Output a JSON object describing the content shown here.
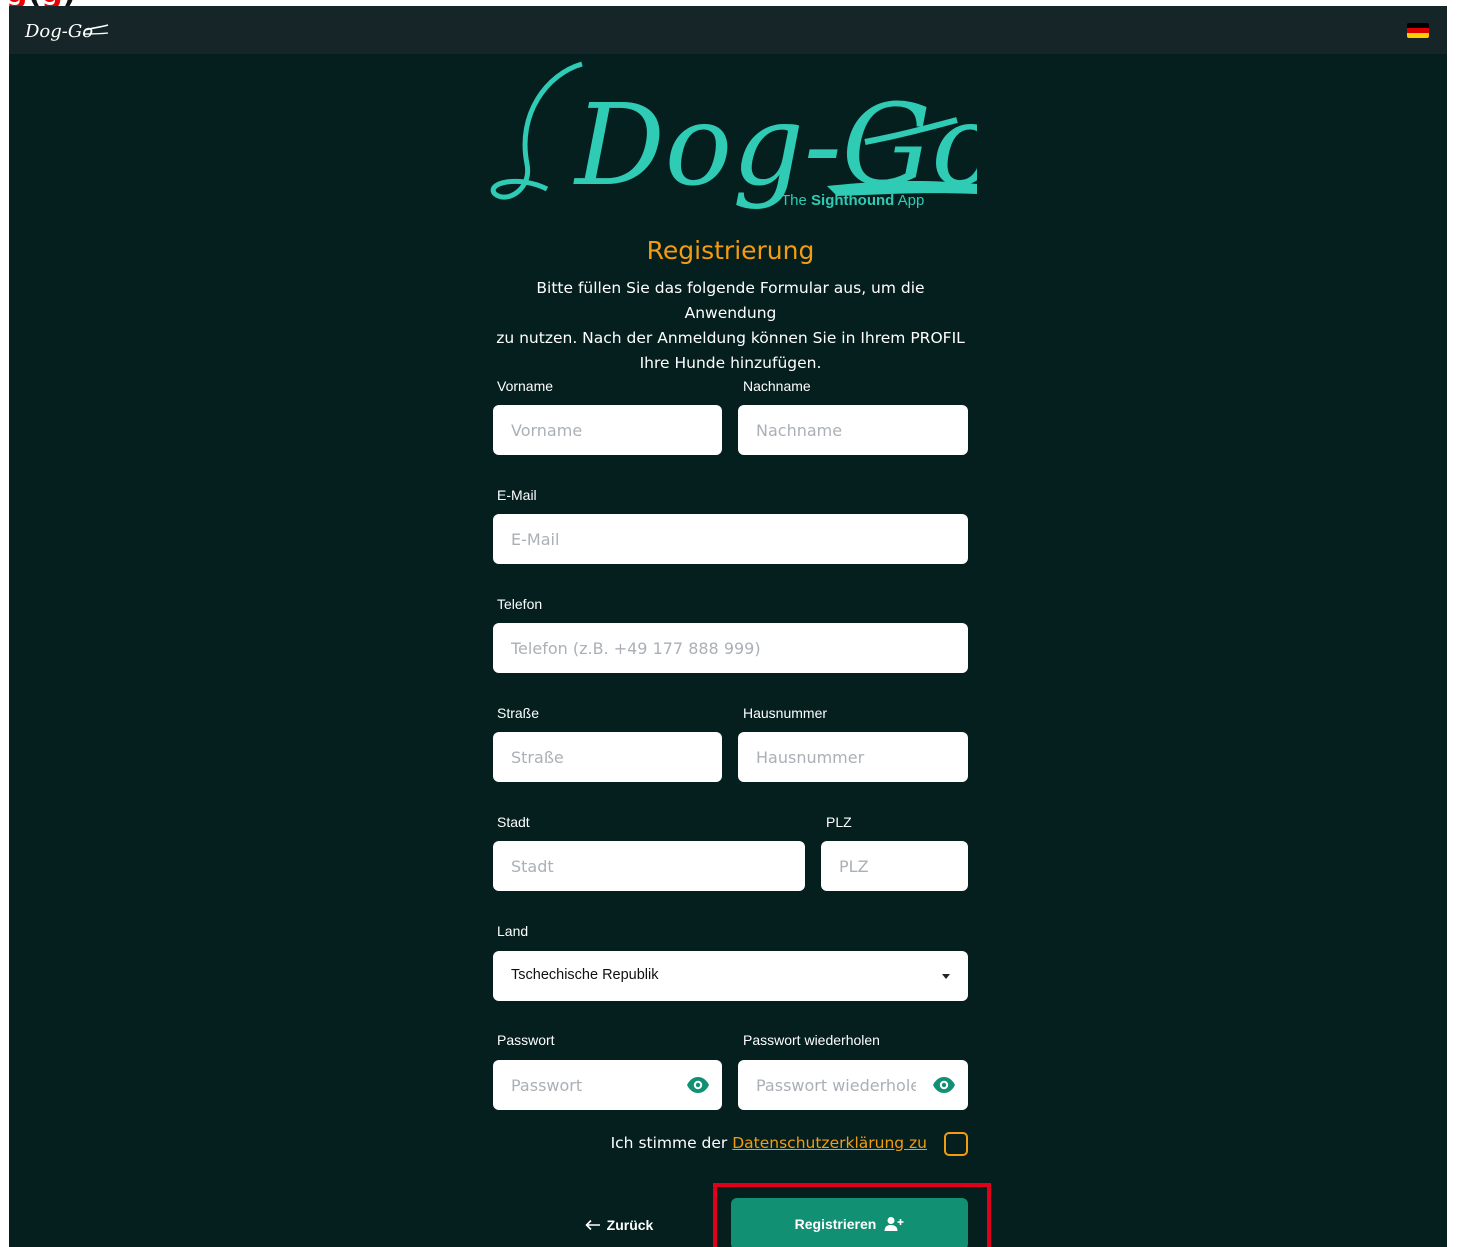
{
  "annotation": {
    "title_red_1": "g",
    "title_black": "(",
    "title_red_2": "g",
    "title_end": ")"
  },
  "header": {
    "app_logo_text": "Dog-Go",
    "language_flag": "Deutsch"
  },
  "logo": {
    "wordmark": "Dog-Go",
    "tagline_prefix": "The ",
    "tagline_bold": "Sighthound",
    "tagline_suffix": " App"
  },
  "page": {
    "title": "Registrierung",
    "intro_line1": "Bitte füllen Sie das folgende Formular aus, um die Anwendung",
    "intro_line2": "zu nutzen. Nach der Anmeldung können Sie in Ihrem PROFIL",
    "intro_line3": "Ihre Hunde hinzufügen."
  },
  "form": {
    "first_name": {
      "label": "Vorname",
      "placeholder": "Vorname",
      "value": ""
    },
    "last_name": {
      "label": "Nachname",
      "placeholder": "Nachname",
      "value": ""
    },
    "email": {
      "label": "E-Mail",
      "placeholder": "E-Mail",
      "value": ""
    },
    "phone": {
      "label": "Telefon",
      "placeholder": "Telefon (z.B. +49 177 888 999)",
      "value": ""
    },
    "street": {
      "label": "Straße",
      "placeholder": "Straße",
      "value": ""
    },
    "house_number": {
      "label": "Hausnummer",
      "placeholder": "Hausnummer",
      "value": ""
    },
    "city": {
      "label": "Stadt",
      "placeholder": "Stadt",
      "value": ""
    },
    "zip": {
      "label": "PLZ",
      "placeholder": "PLZ",
      "value": ""
    },
    "country": {
      "label": "Land",
      "selected": "Tschechische Republik"
    },
    "password": {
      "label": "Passwort",
      "placeholder": "Passwort",
      "value": ""
    },
    "password_repeat": {
      "label": "Passwort wiederholen",
      "placeholder": "Passwort wiederholen",
      "value": ""
    },
    "consent": {
      "text": "Ich stimme der ",
      "link": "Datenschutzerklärung zu",
      "checked": false
    }
  },
  "actions": {
    "back_label": "Zurück",
    "register_label": "Registrieren"
  },
  "colors": {
    "background": "#041f1e",
    "topbar": "#152528",
    "accent_orange": "#f39c12",
    "primary_green": "#119073",
    "logo_teal": "#2fcbb4",
    "highlight_red": "#e0001b"
  }
}
